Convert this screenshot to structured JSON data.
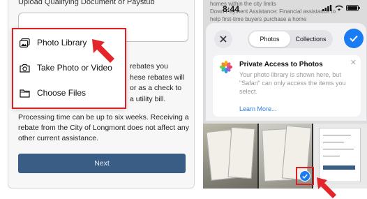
{
  "left": {
    "upload_label": "Upload Qualifying Document or Paystub",
    "menu": [
      {
        "label": "Photo Library",
        "icon": "photo-library-icon"
      },
      {
        "label": "Take Photo or Video",
        "icon": "camera-icon"
      },
      {
        "label": "Choose Files",
        "icon": "folder-icon"
      }
    ],
    "paragraph_fragment": [
      "rebates you",
      "hese rebates will",
      "or as a check to",
      "a utility bill."
    ],
    "processing_text": "Processing time can be up to six weeks. Receiving a rebate from the City of Longmont does not affect any other current assistance.",
    "next_button": "Next"
  },
  "right": {
    "background_text": "homes within the city limits\nDown Payment Assistance: Financial assistance to\nhelp first-time buyers purchase a home",
    "status_time": "8:44",
    "tabs": [
      {
        "label": "Photos",
        "active": true
      },
      {
        "label": "Collections",
        "active": false
      }
    ],
    "info": {
      "title": "Private Access to Photos",
      "body": "Your photo library is shown here, but \"Safari\" can only access the items you select.",
      "link": "Learn More..."
    }
  },
  "colors": {
    "highlight_red": "#d92126",
    "ios_blue": "#1a7cf2",
    "next_button_bg": "#3a5d86"
  }
}
